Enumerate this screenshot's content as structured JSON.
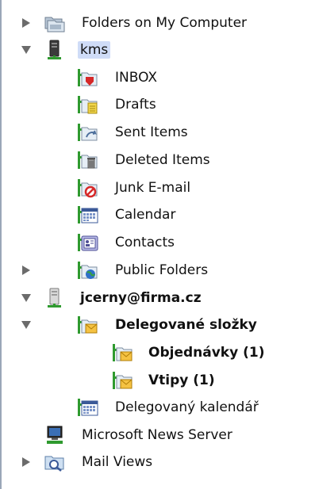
{
  "tree": {
    "items": [
      {
        "label": "Folders on My Computer",
        "icon": "folders-on-computer-icon",
        "expander": "collapsed"
      },
      {
        "label": "kms",
        "icon": "server-account-icon",
        "expander": "expanded",
        "selected": true
      },
      {
        "label": "INBOX",
        "icon": "inbox-icon"
      },
      {
        "label": "Drafts",
        "icon": "drafts-icon"
      },
      {
        "label": "Sent Items",
        "icon": "sent-items-icon"
      },
      {
        "label": "Deleted Items",
        "icon": "deleted-items-icon"
      },
      {
        "label": "Junk E-mail",
        "icon": "junk-email-icon"
      },
      {
        "label": "Calendar",
        "icon": "calendar-icon"
      },
      {
        "label": "Contacts",
        "icon": "contacts-icon"
      },
      {
        "label": "Public Folders",
        "icon": "public-folders-icon",
        "expander": "collapsed"
      },
      {
        "label": "jcerny@firma.cz",
        "icon": "server-account-icon",
        "expander": "expanded",
        "bold": true
      },
      {
        "label": "Delegované složky",
        "icon": "delegated-folder-icon",
        "expander": "expanded",
        "bold": true
      },
      {
        "label": "Objednávky (1)",
        "icon": "delegated-folder-icon",
        "bold": true
      },
      {
        "label": "Vtipy (1)",
        "icon": "delegated-folder-icon",
        "bold": true
      },
      {
        "label": "Delegovaný kalendář",
        "icon": "calendar-icon"
      },
      {
        "label": "Microsoft News Server",
        "icon": "news-server-icon"
      },
      {
        "label": "Mail Views",
        "icon": "mail-views-icon",
        "expander": "collapsed"
      }
    ]
  },
  "colors": {
    "selection": "#cfdcf7",
    "pane_border": "#9aa7b8",
    "expander": "#6b6b6b"
  }
}
